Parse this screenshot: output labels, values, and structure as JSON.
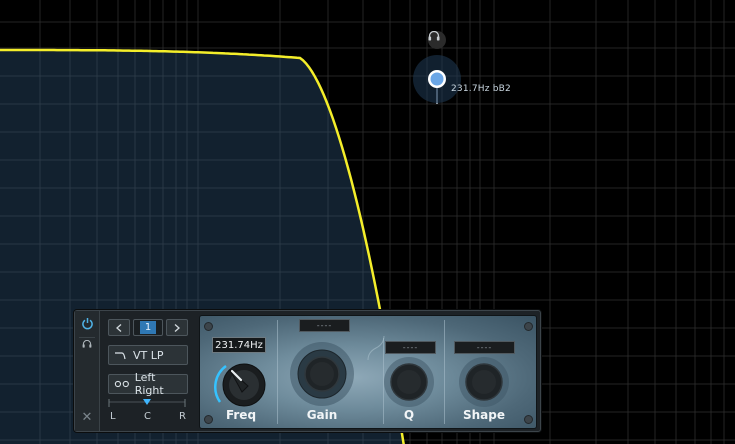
{
  "eq_display": {
    "node_readout": "231.7Hz bB2",
    "colors": {
      "curve": "#f4ee2a",
      "fill": "#12212f",
      "grid": "#2d3c48",
      "node": "#6aa6e6"
    }
  },
  "band_panel": {
    "band_number": "1",
    "filter_type": "VT LP",
    "stereo_mode": "Left Right",
    "stereo_labels": {
      "left": "L",
      "center": "C",
      "right": "R"
    },
    "freq_readout": "231.74Hz",
    "knobs": {
      "freq": "Freq",
      "gain": "Gain",
      "q": "Q",
      "shape": "Shape"
    },
    "value_placeholders": {
      "gain": "----",
      "q": "----",
      "shape": "----"
    }
  }
}
